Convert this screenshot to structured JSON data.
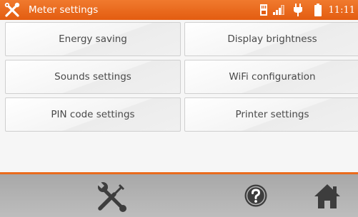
{
  "app": {
    "title": "Meter settings"
  },
  "status_bar": {
    "time": "11:11",
    "icons": [
      "sd-card-icon",
      "signal-icon",
      "power-plug-icon",
      "battery-icon"
    ]
  },
  "menu": {
    "energy_saving": "Energy saving",
    "display_brightness": "Display brightness",
    "sounds_settings": "Sounds settings",
    "wifi_configuration": "WiFi configuration",
    "pin_code_settings": "PIN code settings",
    "printer_settings": "Printer settings"
  },
  "bottom_bar": {
    "icons": [
      "tools-icon",
      "help-icon",
      "home-icon"
    ]
  },
  "colors": {
    "accent": "#e8661a",
    "bottom_bar": "#b3b3b3",
    "button_text": "#4a4a4a"
  }
}
